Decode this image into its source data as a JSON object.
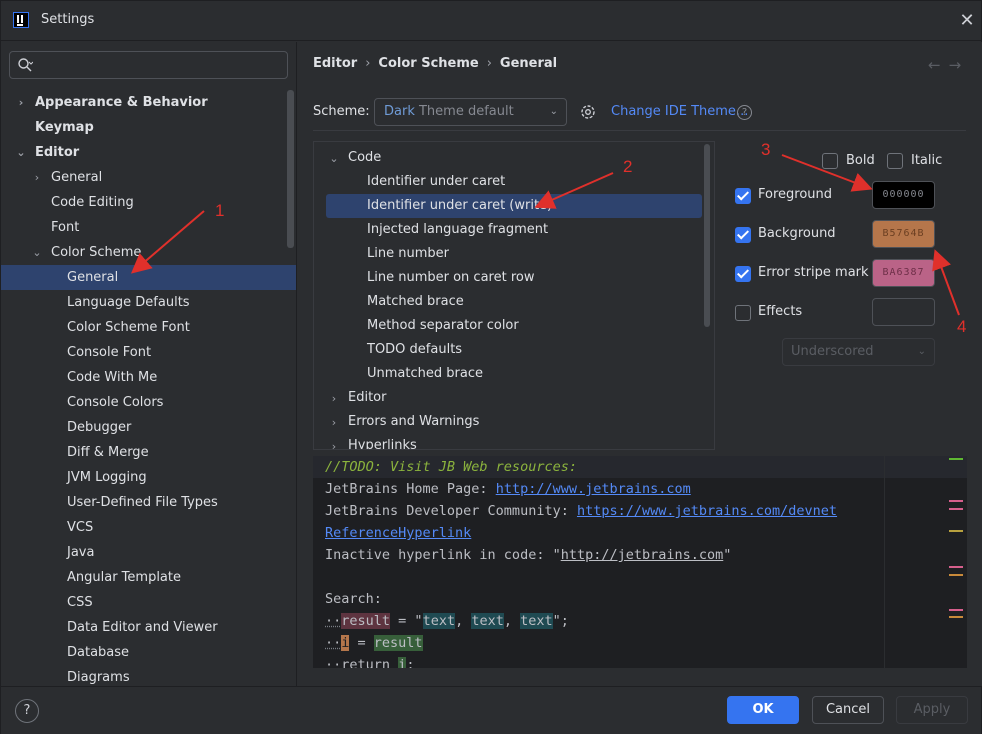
{
  "window": {
    "title": "Settings"
  },
  "search": {
    "placeholder": ""
  },
  "sidebar": {
    "items": [
      {
        "label": "Appearance & Behavior",
        "level": 0,
        "bold": true,
        "caret": "right"
      },
      {
        "label": "Keymap",
        "level": 0,
        "bold": true,
        "caret": ""
      },
      {
        "label": "Editor",
        "level": 0,
        "bold": true,
        "caret": "down"
      },
      {
        "label": "General",
        "level": 1,
        "bold": false,
        "caret": "right"
      },
      {
        "label": "Code Editing",
        "level": 1,
        "bold": false,
        "caret": ""
      },
      {
        "label": "Font",
        "level": 1,
        "bold": false,
        "caret": ""
      },
      {
        "label": "Color Scheme",
        "level": 1,
        "bold": false,
        "caret": "down"
      },
      {
        "label": "General",
        "level": 2,
        "bold": false,
        "caret": "",
        "selected": true
      },
      {
        "label": "Language Defaults",
        "level": 2,
        "bold": false,
        "caret": ""
      },
      {
        "label": "Color Scheme Font",
        "level": 2,
        "bold": false,
        "caret": ""
      },
      {
        "label": "Console Font",
        "level": 2,
        "bold": false,
        "caret": ""
      },
      {
        "label": "Code With Me",
        "level": 2,
        "bold": false,
        "caret": ""
      },
      {
        "label": "Console Colors",
        "level": 2,
        "bold": false,
        "caret": ""
      },
      {
        "label": "Debugger",
        "level": 2,
        "bold": false,
        "caret": ""
      },
      {
        "label": "Diff & Merge",
        "level": 2,
        "bold": false,
        "caret": ""
      },
      {
        "label": "JVM Logging",
        "level": 2,
        "bold": false,
        "caret": ""
      },
      {
        "label": "User-Defined File Types",
        "level": 2,
        "bold": false,
        "caret": ""
      },
      {
        "label": "VCS",
        "level": 2,
        "bold": false,
        "caret": ""
      },
      {
        "label": "Java",
        "level": 2,
        "bold": false,
        "caret": ""
      },
      {
        "label": "Angular Template",
        "level": 2,
        "bold": false,
        "caret": ""
      },
      {
        "label": "CSS",
        "level": 2,
        "bold": false,
        "caret": ""
      },
      {
        "label": "Data Editor and Viewer",
        "level": 2,
        "bold": false,
        "caret": ""
      },
      {
        "label": "Database",
        "level": 2,
        "bold": false,
        "caret": ""
      },
      {
        "label": "Diagrams",
        "level": 2,
        "bold": false,
        "caret": ""
      }
    ]
  },
  "breadcrumb": {
    "items": [
      "Editor",
      "Color Scheme",
      "General"
    ],
    "separator": "›"
  },
  "nav": {
    "back": "←",
    "forward": "→"
  },
  "scheme": {
    "label": "Scheme:",
    "value_first": "Dark",
    "value_rest": " Theme default",
    "change_link": "Change IDE Theme...",
    "help": "?"
  },
  "element_tree": {
    "rows": [
      {
        "label": "Code",
        "level": 0,
        "caret": "down"
      },
      {
        "label": "Identifier under caret",
        "level": 1,
        "caret": ""
      },
      {
        "label": "Identifier under caret (write)",
        "level": 1,
        "caret": "",
        "selected": true
      },
      {
        "label": "Injected language fragment",
        "level": 1,
        "caret": ""
      },
      {
        "label": "Line number",
        "level": 1,
        "caret": ""
      },
      {
        "label": "Line number on caret row",
        "level": 1,
        "caret": ""
      },
      {
        "label": "Matched brace",
        "level": 1,
        "caret": ""
      },
      {
        "label": "Method separator color",
        "level": 1,
        "caret": ""
      },
      {
        "label": "TODO defaults",
        "level": 1,
        "caret": ""
      },
      {
        "label": "Unmatched brace",
        "level": 1,
        "caret": ""
      },
      {
        "label": "Editor",
        "level": 0,
        "caret": "right"
      },
      {
        "label": "Errors and Warnings",
        "level": 0,
        "caret": "right"
      },
      {
        "label": "Hyperlinks",
        "level": 0,
        "caret": "right"
      }
    ]
  },
  "options": {
    "bold": {
      "label": "Bold",
      "checked": false
    },
    "italic": {
      "label": "Italic",
      "checked": false
    },
    "foreground": {
      "label": "Foreground",
      "checked": true,
      "hex": "000000",
      "color": "#000000"
    },
    "background": {
      "label": "Background",
      "checked": true,
      "hex": "B5764B",
      "color": "#B5764B"
    },
    "error_stripe": {
      "label": "Error stripe mark",
      "checked": true,
      "hex": "BA6387",
      "color": "#BA6387"
    },
    "effects": {
      "label": "Effects",
      "checked": false,
      "style": "Underscored"
    }
  },
  "preview": {
    "line1": "//TODO: Visit JB Web resources:",
    "line2_prefix": "JetBrains Home Page: ",
    "line2_link": "http://www.jetbrains.com",
    "line3_prefix": "JetBrains Developer Community: ",
    "line3_link": "https://www.jetbrains.com/devnet",
    "line4": "ReferenceHyperlink",
    "line5_prefix": "Inactive hyperlink in code: \"",
    "line5_link": "http://jetbrains.com",
    "line5_suffix": "\"",
    "line7": "Search:",
    "line8_a": "result",
    "line8_b": " = \"",
    "line8_c": "text",
    "line8_d": ", ",
    "line8_e": "text",
    "line8_f": ", ",
    "line8_g": "text",
    "line8_h": "\";",
    "line9_a": "i",
    "line9_b": " = ",
    "line9_c": "result",
    "line10_a": "return ",
    "line10_b": "i",
    "line10_c": ";",
    "stripe_colors": [
      "#5fb832",
      "#d65f8c",
      "#d65f8c",
      "#b8a13f",
      "#d65f8c",
      "#c98a3a",
      "#d65f8c",
      "#c98a3a"
    ]
  },
  "buttons": {
    "help": "?",
    "ok": "OK",
    "cancel": "Cancel",
    "apply": "Apply"
  },
  "annotations": {
    "a1": "1",
    "a2": "2",
    "a3": "3",
    "a4": "4",
    "color": "#e0302b"
  }
}
